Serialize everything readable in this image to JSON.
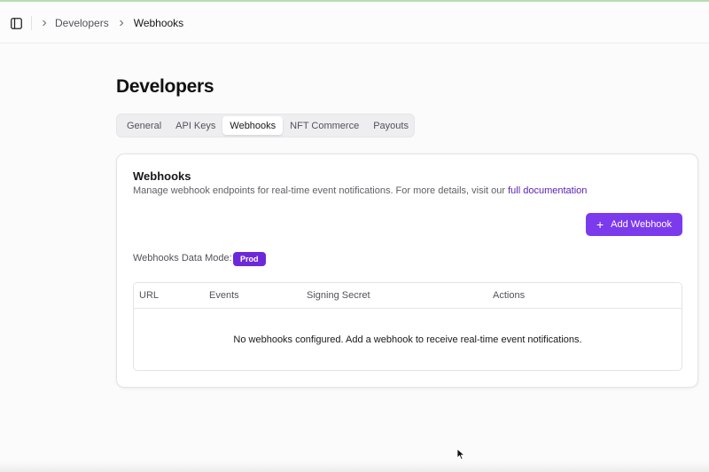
{
  "breadcrumb": {
    "items": [
      "Developers",
      "Webhooks"
    ]
  },
  "page": {
    "title": "Developers"
  },
  "tabs": [
    {
      "label": "General",
      "active": false
    },
    {
      "label": "API Keys",
      "active": false
    },
    {
      "label": "Webhooks",
      "active": true
    },
    {
      "label": "NFT Commerce",
      "active": false
    },
    {
      "label": "Payouts",
      "active": false
    }
  ],
  "card": {
    "title": "Webhooks",
    "description": "Manage webhook endpoints for real-time event notifications. For more details, visit our ",
    "doc_link": "full documentation",
    "add_button": "Add Webhook",
    "mode_label": "Webhooks Data Mode:",
    "mode_badge": "Prod"
  },
  "table": {
    "columns": [
      "URL",
      "Events",
      "Signing Secret",
      "Actions"
    ],
    "empty_text": "No webhooks configured. Add a webhook to receive real-time event notifications."
  },
  "colors": {
    "accent": "#7c3aed",
    "badge": "#6d28d9",
    "link": "#5b21b6"
  }
}
